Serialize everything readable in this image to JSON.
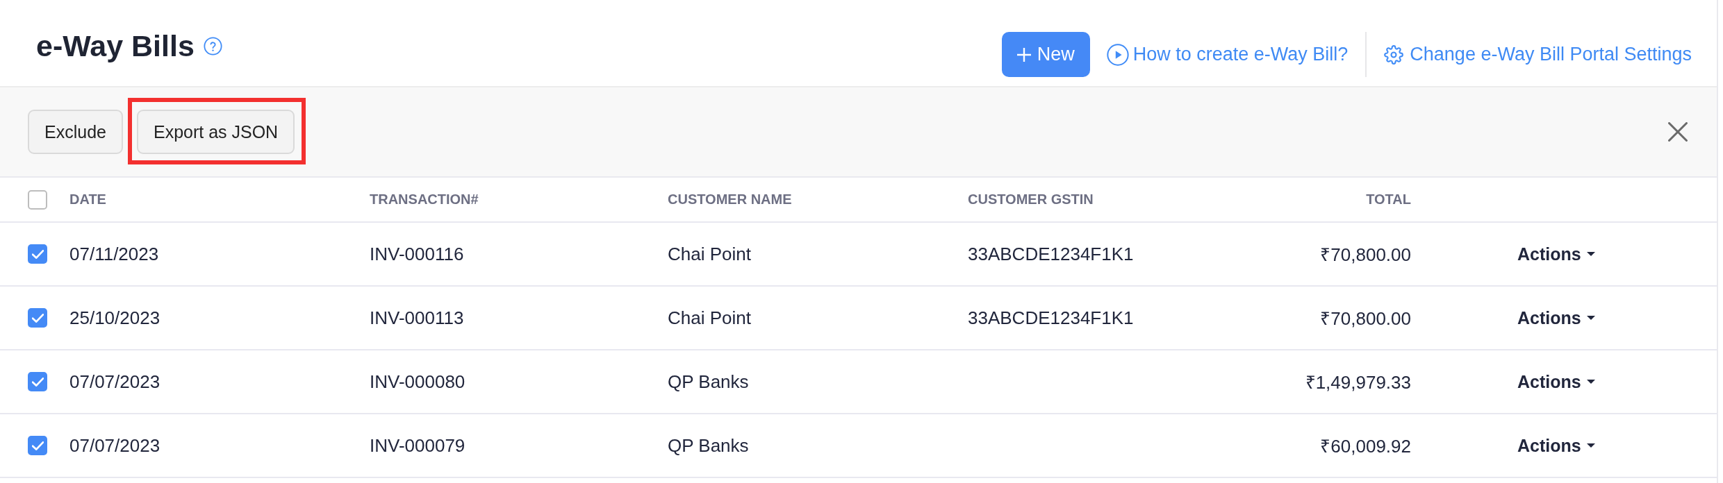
{
  "page": {
    "title": "e-Way Bills"
  },
  "header_actions": {
    "new_button": "New",
    "links": [
      {
        "kind": "video",
        "label": "How to create e-Way Bill?"
      },
      {
        "kind": "settings",
        "label": "Change e-Way Bill Portal Settings"
      }
    ]
  },
  "bulk_toolbar": {
    "buttons": [
      {
        "label": "Exclude",
        "highlighted": false
      },
      {
        "label": "Export as JSON",
        "highlighted": true
      }
    ]
  },
  "table": {
    "select_all_checked": false,
    "columns": [
      {
        "label": "DATE",
        "kind": "text"
      },
      {
        "label": "TRANSACTION#",
        "kind": "text"
      },
      {
        "label": "CUSTOMER NAME",
        "kind": "text"
      },
      {
        "label": "CUSTOMER GSTIN",
        "kind": "text"
      },
      {
        "label": "TOTAL",
        "kind": "amount"
      }
    ],
    "rows": [
      {
        "checked": true,
        "date": "07/11/2023",
        "transaction": "INV-000116",
        "customer_name": "Chai Point",
        "customer_gstin": "33ABCDE1234F1K1",
        "total": "₹70,800.00",
        "actions": "Actions"
      },
      {
        "checked": true,
        "date": "25/10/2023",
        "transaction": "INV-000113",
        "customer_name": "Chai Point",
        "customer_gstin": "33ABCDE1234F1K1",
        "total": "₹70,800.00",
        "actions": "Actions"
      },
      {
        "checked": true,
        "date": "07/07/2023",
        "transaction": "INV-000080",
        "customer_name": "QP Banks",
        "total": "₹1,49,979.33",
        "actions": "Actions"
      },
      {
        "checked": true,
        "date": "07/07/2023",
        "transaction": "INV-000079",
        "customer_name": "QP Banks",
        "total": "₹60,009.92",
        "actions": "Actions"
      }
    ]
  }
}
